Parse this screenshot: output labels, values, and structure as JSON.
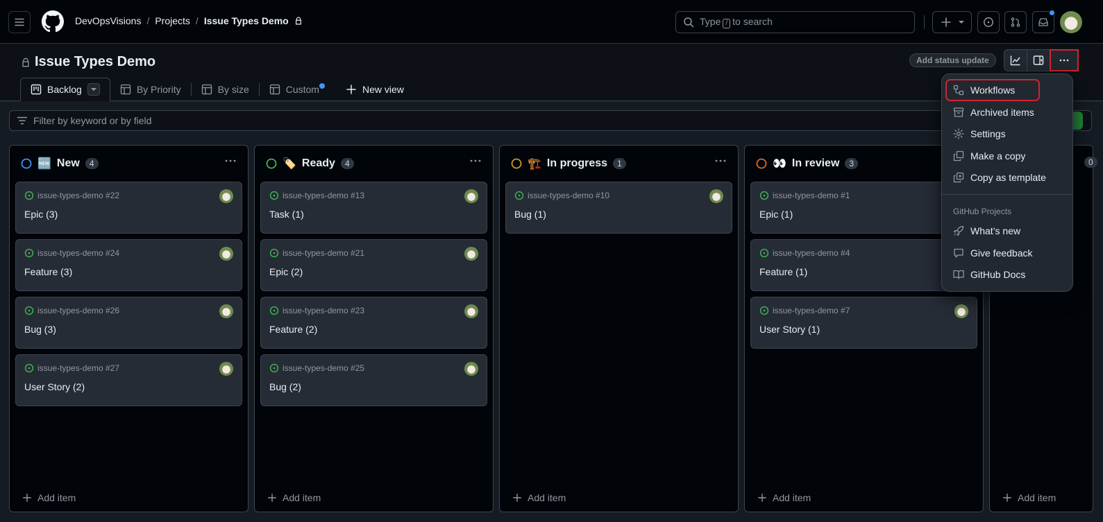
{
  "header": {
    "breadcrumb": [
      "DevOpsVisions",
      "Projects",
      "Issue Types Demo"
    ],
    "search_placeholder_pre": "Type",
    "search_key": "/",
    "search_placeholder_post": "to search"
  },
  "project": {
    "title": "Issue Types Demo",
    "status_update_label": "Add status update"
  },
  "tabs": [
    {
      "label": "Backlog",
      "icon": "board-icon",
      "active": true
    },
    {
      "label": "By Priority",
      "icon": "table-icon"
    },
    {
      "label": "By size",
      "icon": "table-icon"
    },
    {
      "label": "Custom",
      "icon": "table-icon",
      "dot": true
    },
    {
      "label": "New view",
      "icon": "plus-icon"
    }
  ],
  "filter": {
    "placeholder": "Filter by keyword or by field"
  },
  "columns": [
    {
      "name": "New",
      "emoji": "🆕",
      "status_color": "#4493f8",
      "count": "4",
      "cards": [
        {
          "ref": "issue-types-demo #22",
          "title": "Epic (3)"
        },
        {
          "ref": "issue-types-demo #24",
          "title": "Feature (3)"
        },
        {
          "ref": "issue-types-demo #26",
          "title": "Bug (3)"
        },
        {
          "ref": "issue-types-demo #27",
          "title": "User Story (2)"
        }
      ]
    },
    {
      "name": "Ready",
      "emoji": "🏷️",
      "status_color": "#3fb950",
      "count": "4",
      "cards": [
        {
          "ref": "issue-types-demo #13",
          "title": "Task (1)"
        },
        {
          "ref": "issue-types-demo #21",
          "title": "Epic (2)"
        },
        {
          "ref": "issue-types-demo #23",
          "title": "Feature (2)"
        },
        {
          "ref": "issue-types-demo #25",
          "title": "Bug (2)"
        }
      ]
    },
    {
      "name": "In progress",
      "emoji": "🏗️",
      "status_color": "#d29922",
      "count": "1",
      "cards": [
        {
          "ref": "issue-types-demo #10",
          "title": "Bug (1)"
        }
      ]
    },
    {
      "name": "In review",
      "emoji": "👀",
      "status_color": "#db6d28",
      "count": "3",
      "cards": [
        {
          "ref": "issue-types-demo #1",
          "title": "Epic (1)"
        },
        {
          "ref": "issue-types-demo #4",
          "title": "Feature (1)"
        },
        {
          "ref": "issue-types-demo #7",
          "title": "User Story (1)"
        }
      ]
    },
    {
      "name": "",
      "emoji": "",
      "status_color": "",
      "count": "0",
      "cards": []
    }
  ],
  "add_item_label": "Add item",
  "menu": {
    "items": [
      {
        "label": "Workflows",
        "icon": "workflow-icon"
      },
      {
        "label": "Archived items",
        "icon": "archive-icon"
      },
      {
        "label": "Settings",
        "icon": "gear-icon"
      },
      {
        "label": "Make a copy",
        "icon": "copy-icon"
      },
      {
        "label": "Copy as template",
        "icon": "duplicate-icon"
      }
    ],
    "group_label": "GitHub Projects",
    "group_items": [
      {
        "label": "What’s new",
        "icon": "rocket-icon"
      },
      {
        "label": "Give feedback",
        "icon": "comment-icon"
      },
      {
        "label": "GitHub Docs",
        "icon": "book-icon"
      }
    ]
  }
}
